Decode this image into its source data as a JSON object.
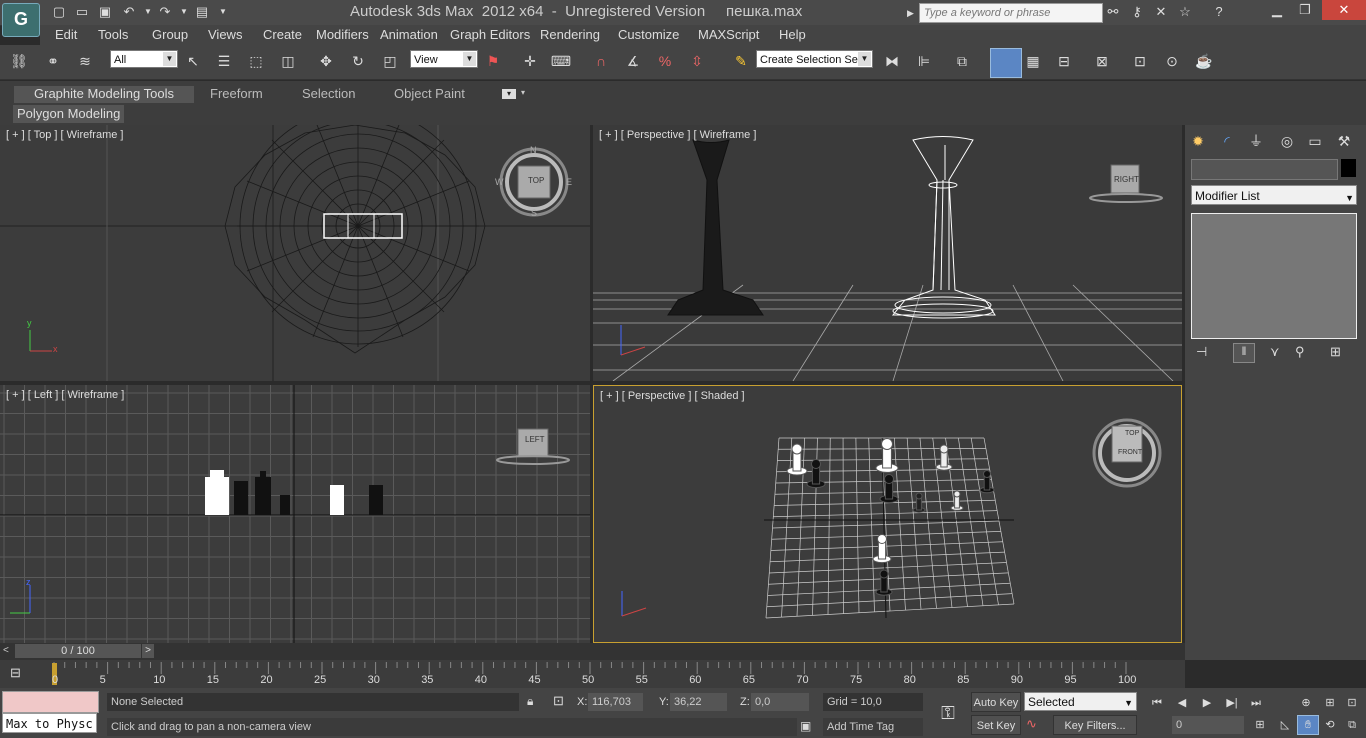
{
  "window": {
    "title": "Autodesk 3ds Max  2012 x64  -  Unregistered Version     пешка.max",
    "search_placeholder": "Type a keyword or phrase",
    "logo": "G"
  },
  "menu": [
    "Edit",
    "Tools",
    "Group",
    "Views",
    "Create",
    "Modifiers",
    "Animation",
    "Graph Editors",
    "Rendering",
    "Customize",
    "MAXScript",
    "Help"
  ],
  "toolbar": {
    "filter_value": "All",
    "ref_coord_value": "View",
    "selection_set_value": "Create Selection Se"
  },
  "ribbon": {
    "tabs": [
      "Graphite Modeling Tools",
      "Freeform",
      "Selection",
      "Object Paint"
    ],
    "panel": "Polygon Modeling"
  },
  "viewports": {
    "top": "[ + ] [ Top ] [ Wireframe ]",
    "persp_wire": "[ + ] [ Perspective ] [ Wireframe ]",
    "left": "[ + ] [ Left ] [ Wireframe ]",
    "persp_shaded": "[ + ] [ Perspective ] [ Shaded ]",
    "viewcube_top": "TOP",
    "viewcube_right": "RIGHT",
    "viewcube_left": "LEFT",
    "viewcube_persp_top": "TOP",
    "viewcube_persp_front": "FRONT",
    "compass": {
      "n": "N",
      "s": "S",
      "e": "E",
      "w": "W"
    },
    "axes": {
      "x": "x",
      "y": "y",
      "z": "z"
    }
  },
  "command_panel": {
    "modifier_list": "Modifier List"
  },
  "timeline": {
    "slider": "0 / 100",
    "ticks": [
      "0",
      "5",
      "10",
      "15",
      "20",
      "25",
      "30",
      "35",
      "40",
      "45",
      "50",
      "55",
      "60",
      "65",
      "70",
      "75",
      "80",
      "85",
      "90",
      "95",
      "100"
    ]
  },
  "status": {
    "maxscript": "Max to Physc",
    "selection": "None Selected",
    "prompt": "Click and drag to pan a non-camera view",
    "x_label": "X:",
    "x_value": "116,703",
    "y_label": "Y:",
    "y_value": "36,22",
    "z_label": "Z:",
    "z_value": "0,0",
    "grid": "Grid = 10,0",
    "add_time_tag": "Add Time Tag",
    "auto_key": "Auto Key",
    "set_key": "Set Key",
    "key_mode": "Selected",
    "key_filters": "Key Filters...",
    "frame": "0"
  }
}
